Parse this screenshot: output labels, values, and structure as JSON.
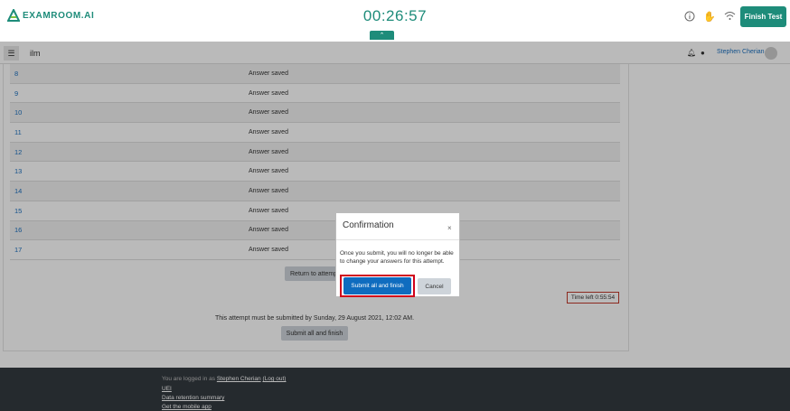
{
  "header": {
    "logo_text": "EXAMROOM.AI",
    "timer": "00:26:57",
    "finish_label": "Finish Test"
  },
  "navbar": {
    "site_name": "ilm",
    "user_name": "Stephen Cherian"
  },
  "summary": {
    "rows": [
      {
        "num": "8",
        "status": "Answer saved"
      },
      {
        "num": "9",
        "status": "Answer saved"
      },
      {
        "num": "10",
        "status": "Answer saved"
      },
      {
        "num": "11",
        "status": "Answer saved"
      },
      {
        "num": "12",
        "status": "Answer saved"
      },
      {
        "num": "13",
        "status": "Answer saved"
      },
      {
        "num": "14",
        "status": "Answer saved"
      },
      {
        "num": "15",
        "status": "Answer saved"
      },
      {
        "num": "16",
        "status": "Answer saved"
      },
      {
        "num": "17",
        "status": "Answer saved"
      }
    ],
    "return_label": "Return to attempt",
    "time_left": "Time left 0:55:54",
    "submit_note": "This attempt must be submitted by Sunday, 29 August 2021, 12:02 AM.",
    "submit_label": "Submit all and finish"
  },
  "footer": {
    "logged_in_prefix": "You are logged in as ",
    "user_name": "Stephen Cherian",
    "logout": "(Log out)",
    "link_1": "UEI",
    "link_2": "Data retention summary",
    "link_3": "Get the mobile app"
  },
  "modal": {
    "title": "Confirmation",
    "close": "×",
    "body": "Once you submit, you will no longer be able to change your answers for this attempt.",
    "submit_label": "Submit all and finish",
    "cancel_label": "Cancel"
  },
  "colors": {
    "brand": "#1e8c7a",
    "primary_button": "#0f6cbf",
    "highlight": "#d0021b"
  }
}
